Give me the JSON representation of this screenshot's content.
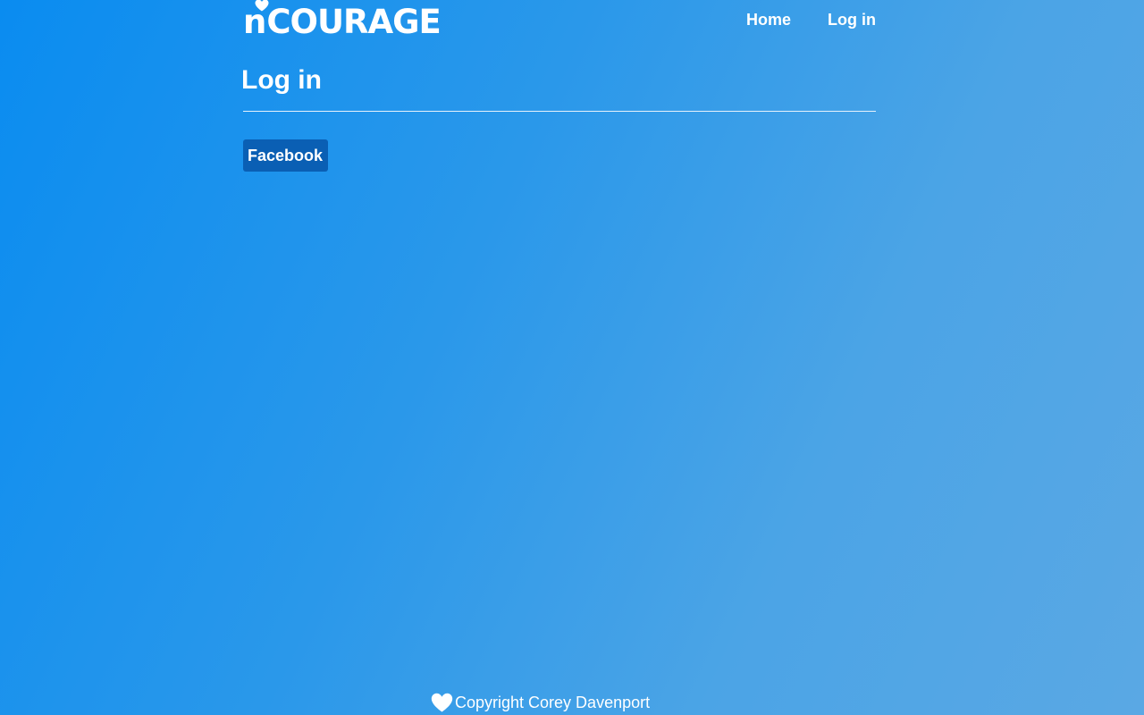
{
  "header": {
    "logo_text": "n'COURAGE",
    "logo_letter": "n",
    "logo_word": "COURAGE",
    "nav": [
      {
        "label": "Home"
      },
      {
        "label": "Log in"
      }
    ]
  },
  "main": {
    "title": "Log in",
    "facebook_button_label": "Facebook"
  },
  "footer": {
    "text": "Copyright Corey Davenport",
    "icon": "heart-icon"
  },
  "colors": {
    "background_start": "#0a8cf0",
    "background_end": "#5aa8e4",
    "button": "#0a5fb4",
    "text": "#ffffff"
  }
}
